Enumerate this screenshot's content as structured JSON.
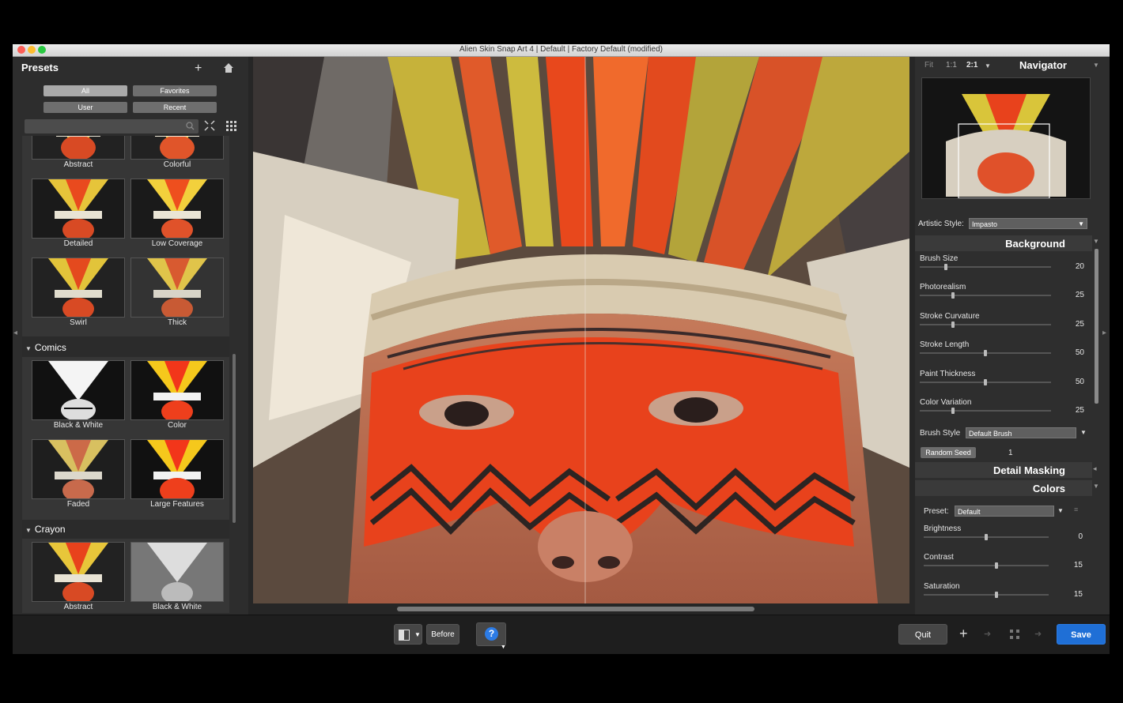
{
  "window": {
    "title": "Alien Skin Snap Art 4 | Default | Factory Default (modified)"
  },
  "presets": {
    "title": "Presets",
    "filters": [
      "All",
      "Favorites",
      "User",
      "Recent"
    ],
    "groups": [
      {
        "items": [
          "Abstract",
          "Colorful",
          "Detailed",
          "Low Coverage",
          "Swirl",
          "Thick"
        ]
      },
      {
        "name": "Comics",
        "items": [
          "Black & White",
          "Color",
          "Faded",
          "Large Features"
        ]
      },
      {
        "name": "Crayon",
        "items": [
          "Abstract",
          "Black & White"
        ]
      }
    ]
  },
  "navigator": {
    "title": "Navigator",
    "zoom": [
      "Fit",
      "1:1",
      "2:1"
    ]
  },
  "artistic_style": {
    "label": "Artistic Style:",
    "value": "Impasto"
  },
  "background": {
    "title": "Background",
    "sliders": [
      {
        "label": "Brush Size",
        "value": "20",
        "level": 0.2
      },
      {
        "label": "Photorealism",
        "value": "25",
        "level": 0.25
      },
      {
        "label": "Stroke Curvature",
        "value": "25",
        "level": 0.25
      },
      {
        "label": "Stroke Length",
        "value": "50",
        "level": 0.5
      },
      {
        "label": "Paint Thickness",
        "value": "50",
        "level": 0.5
      },
      {
        "label": "Color Variation",
        "value": "25",
        "level": 0.25
      }
    ],
    "brush_style_label": "Brush Style",
    "brush_style_value": "Default Brush",
    "random_seed_label": "Random Seed",
    "random_seed_value": "1"
  },
  "detail_masking": {
    "title": "Detail Masking"
  },
  "colors": {
    "title": "Colors",
    "preset_label": "Preset:",
    "preset_value": "Default",
    "sliders": [
      {
        "label": "Brightness",
        "value": "0",
        "level": 0.5
      },
      {
        "label": "Contrast",
        "value": "15",
        "level": 0.58
      },
      {
        "label": "Saturation",
        "value": "15",
        "level": 0.58
      }
    ]
  },
  "toolbar": {
    "before_label": "Before",
    "quit_label": "Quit",
    "save_label": "Save",
    "help_symbol": "?"
  },
  "colors_palette": {
    "accent": "#1f6fd6",
    "panel": "#2e2e2e",
    "face_paint": "#e8421c"
  }
}
